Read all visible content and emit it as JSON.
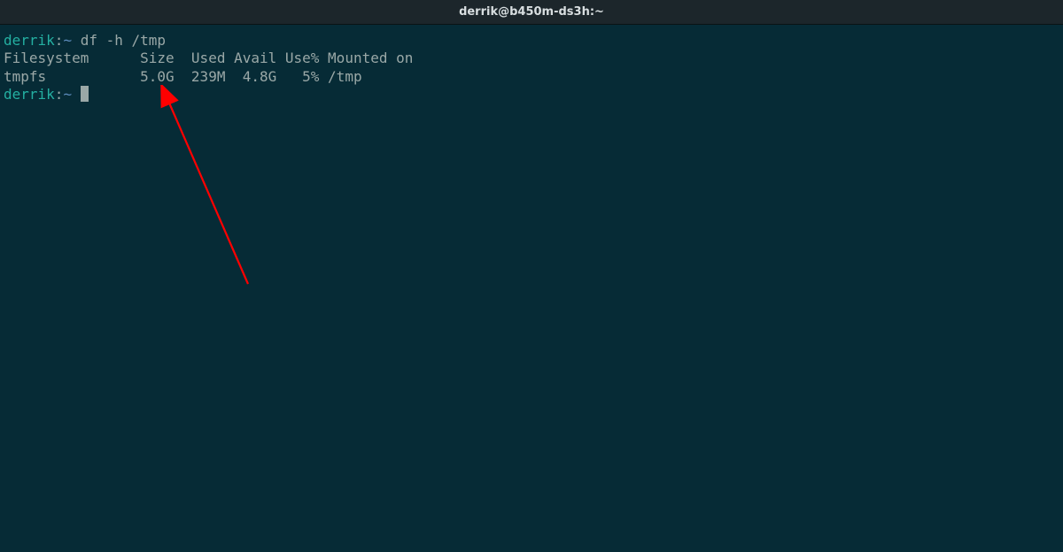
{
  "window": {
    "title": "derrik@b450m-ds3h:~"
  },
  "prompt": {
    "user": "derrik",
    "separator": ":",
    "path": "~",
    "symbol": " "
  },
  "session": {
    "command1": "df -h /tmp",
    "output_header": "Filesystem      Size  Used Avail Use% Mounted on",
    "output_row": "tmpfs           5.0G  239M  4.8G   5% /tmp"
  },
  "df_data": {
    "filesystem": "tmpfs",
    "size": "5.0G",
    "used": "239M",
    "avail": "4.8G",
    "use_pct": "5%",
    "mounted_on": "/tmp"
  },
  "annotation": {
    "color": "#ff0000"
  }
}
